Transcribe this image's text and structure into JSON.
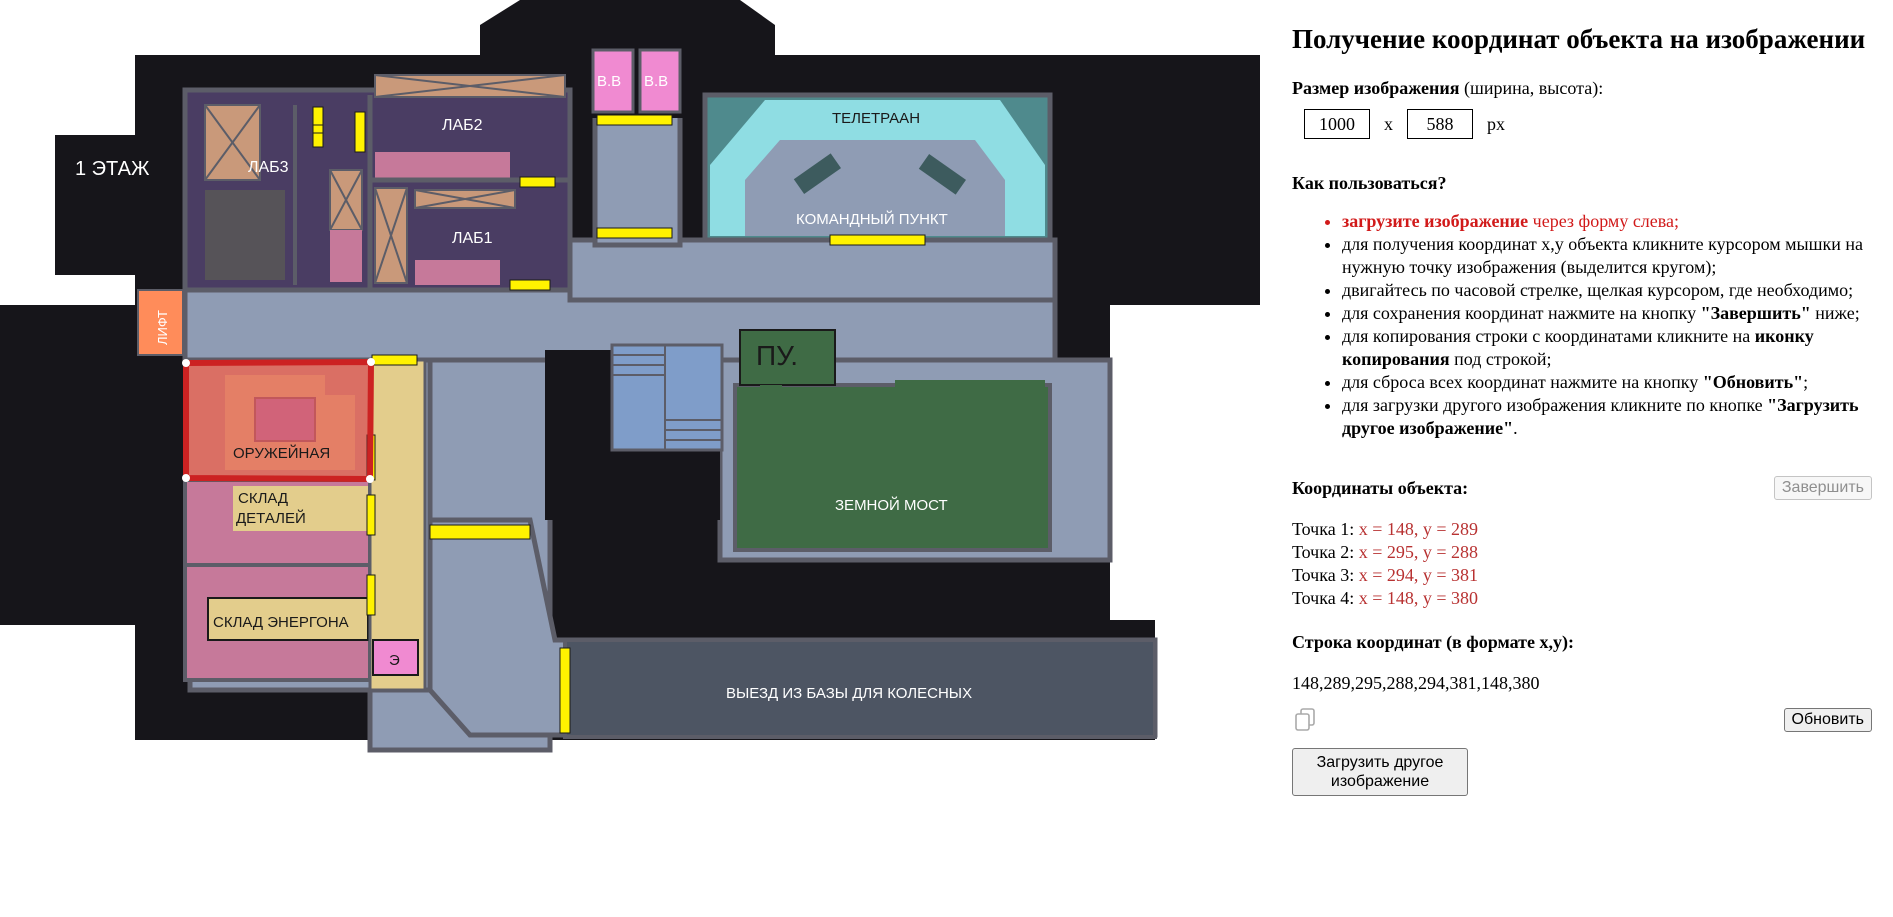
{
  "map": {
    "floor_label": "1 ЭТАЖ",
    "rooms": {
      "lab1": "ЛАБ1",
      "lab2": "ЛАБ2",
      "lab3": "ЛАБ3",
      "vv1": "В.В",
      "vv2": "В.В",
      "teletraan": "ТЕЛЕТРААН",
      "command": "КОМАНДНЫЙ ПУНКТ",
      "lift": "ЛИФТ",
      "armory": "ОРУЖЕЙНАЯ",
      "parts_line1": "СКЛАД",
      "parts_line2": "ДЕТАЛЕЙ",
      "energon": "СКЛАД ЭНЕРГОНА",
      "e_room": "Э",
      "pu": "ПУ.",
      "ground_bridge": "ЗЕМНОЙ МОСТ",
      "exit": "ВЫЕЗД ИЗ БАЗЫ ДЛЯ КОЛЕСНЫХ"
    },
    "colors": {
      "background": "#16151a",
      "corridor": "#8f9cb4",
      "lab": "#4a3d63",
      "teletraan": "#8fdde3",
      "ground_bridge": "#3f6b45",
      "storage": "#c6799a",
      "armory": "#e39a79",
      "door": "#fff200",
      "selection": "#cc2222"
    }
  },
  "panel": {
    "title": "Получение координат объекта на изображении",
    "size_label_bold": "Размер изображения",
    "size_label_rest": " (ширина, высота):",
    "width": "1000",
    "sep": "x",
    "height": "588",
    "unit": "px",
    "howto_title": "Как пользоваться?",
    "howto": {
      "i1_bold": "загрузите изображение",
      "i1_rest": " через форму слева;",
      "i2": "для получения координат x,y объекта кликните курсором мышки на нужную точку изображения (выделится кругом);",
      "i3": "двигайтесь по часовой стрелке, щелкая курсором, где необходимо;",
      "i4_a": "для сохранения координат нажмите на кнопку ",
      "i4_b": "\"Завершить\"",
      "i4_c": " ниже;",
      "i5_a": "для копирования строки с координатами кликните на ",
      "i5_b": "иконку копирования",
      "i5_c": " под строкой;",
      "i6_a": "для сброса всех координат нажмите на кнопку ",
      "i6_b": "\"Обновить\"",
      "i6_c": ";",
      "i7_a": "для загрузки другого изображения кликните по кнопке ",
      "i7_b": "\"Загрузить другое изображение\"",
      "i7_c": "."
    },
    "coords_title": "Координаты объекта:",
    "finish_button": "Завершить",
    "points": [
      {
        "label": "Точка 1: ",
        "value": "x = 148, y = 289"
      },
      {
        "label": "Точка 2: ",
        "value": "x = 295, y = 288"
      },
      {
        "label": "Точка 3: ",
        "value": "x = 294, y = 381"
      },
      {
        "label": "Точка 4: ",
        "value": "x = 148, y = 380"
      }
    ],
    "coord_string_title": "Строка координат (в формате x,y):",
    "coord_string": "148,289,295,288,294,381,148,380",
    "refresh_button": "Обновить",
    "upload_button": "Загрузить другое изображение"
  }
}
